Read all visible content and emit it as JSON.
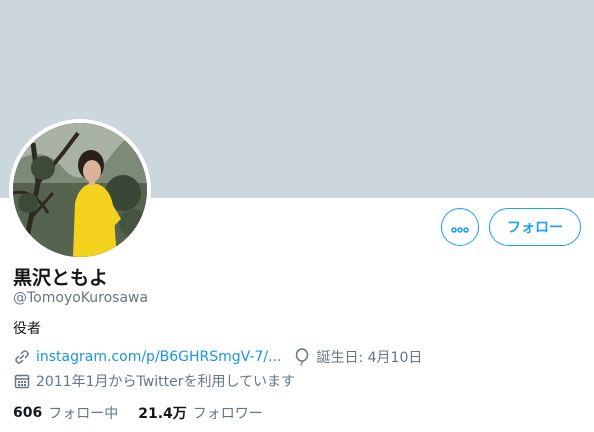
{
  "profile": {
    "display_name": "黒沢ともよ",
    "handle": "@TomoyoKurosawa",
    "bio": "役者",
    "link_text": "instagram.com/p/B6GHRSmgV-7/...",
    "birthday": "誕生日: 4月10日",
    "joined": "2011年1月からTwitterを利用しています"
  },
  "actions": {
    "follow_label": "フォロー",
    "more_icon": "more-dots-icon"
  },
  "stats": {
    "following_count": "606",
    "following_label": "フォロー中",
    "followers_count": "21.4万",
    "followers_label": "フォロワー"
  },
  "icons": {
    "link": "link-icon",
    "birthday": "balloon-icon",
    "joined": "calendar-icon"
  },
  "colors": {
    "accent": "#1da1f2",
    "link": "#1b95e0",
    "banner": "#ccd6dd",
    "secondary_text": "#657786"
  }
}
